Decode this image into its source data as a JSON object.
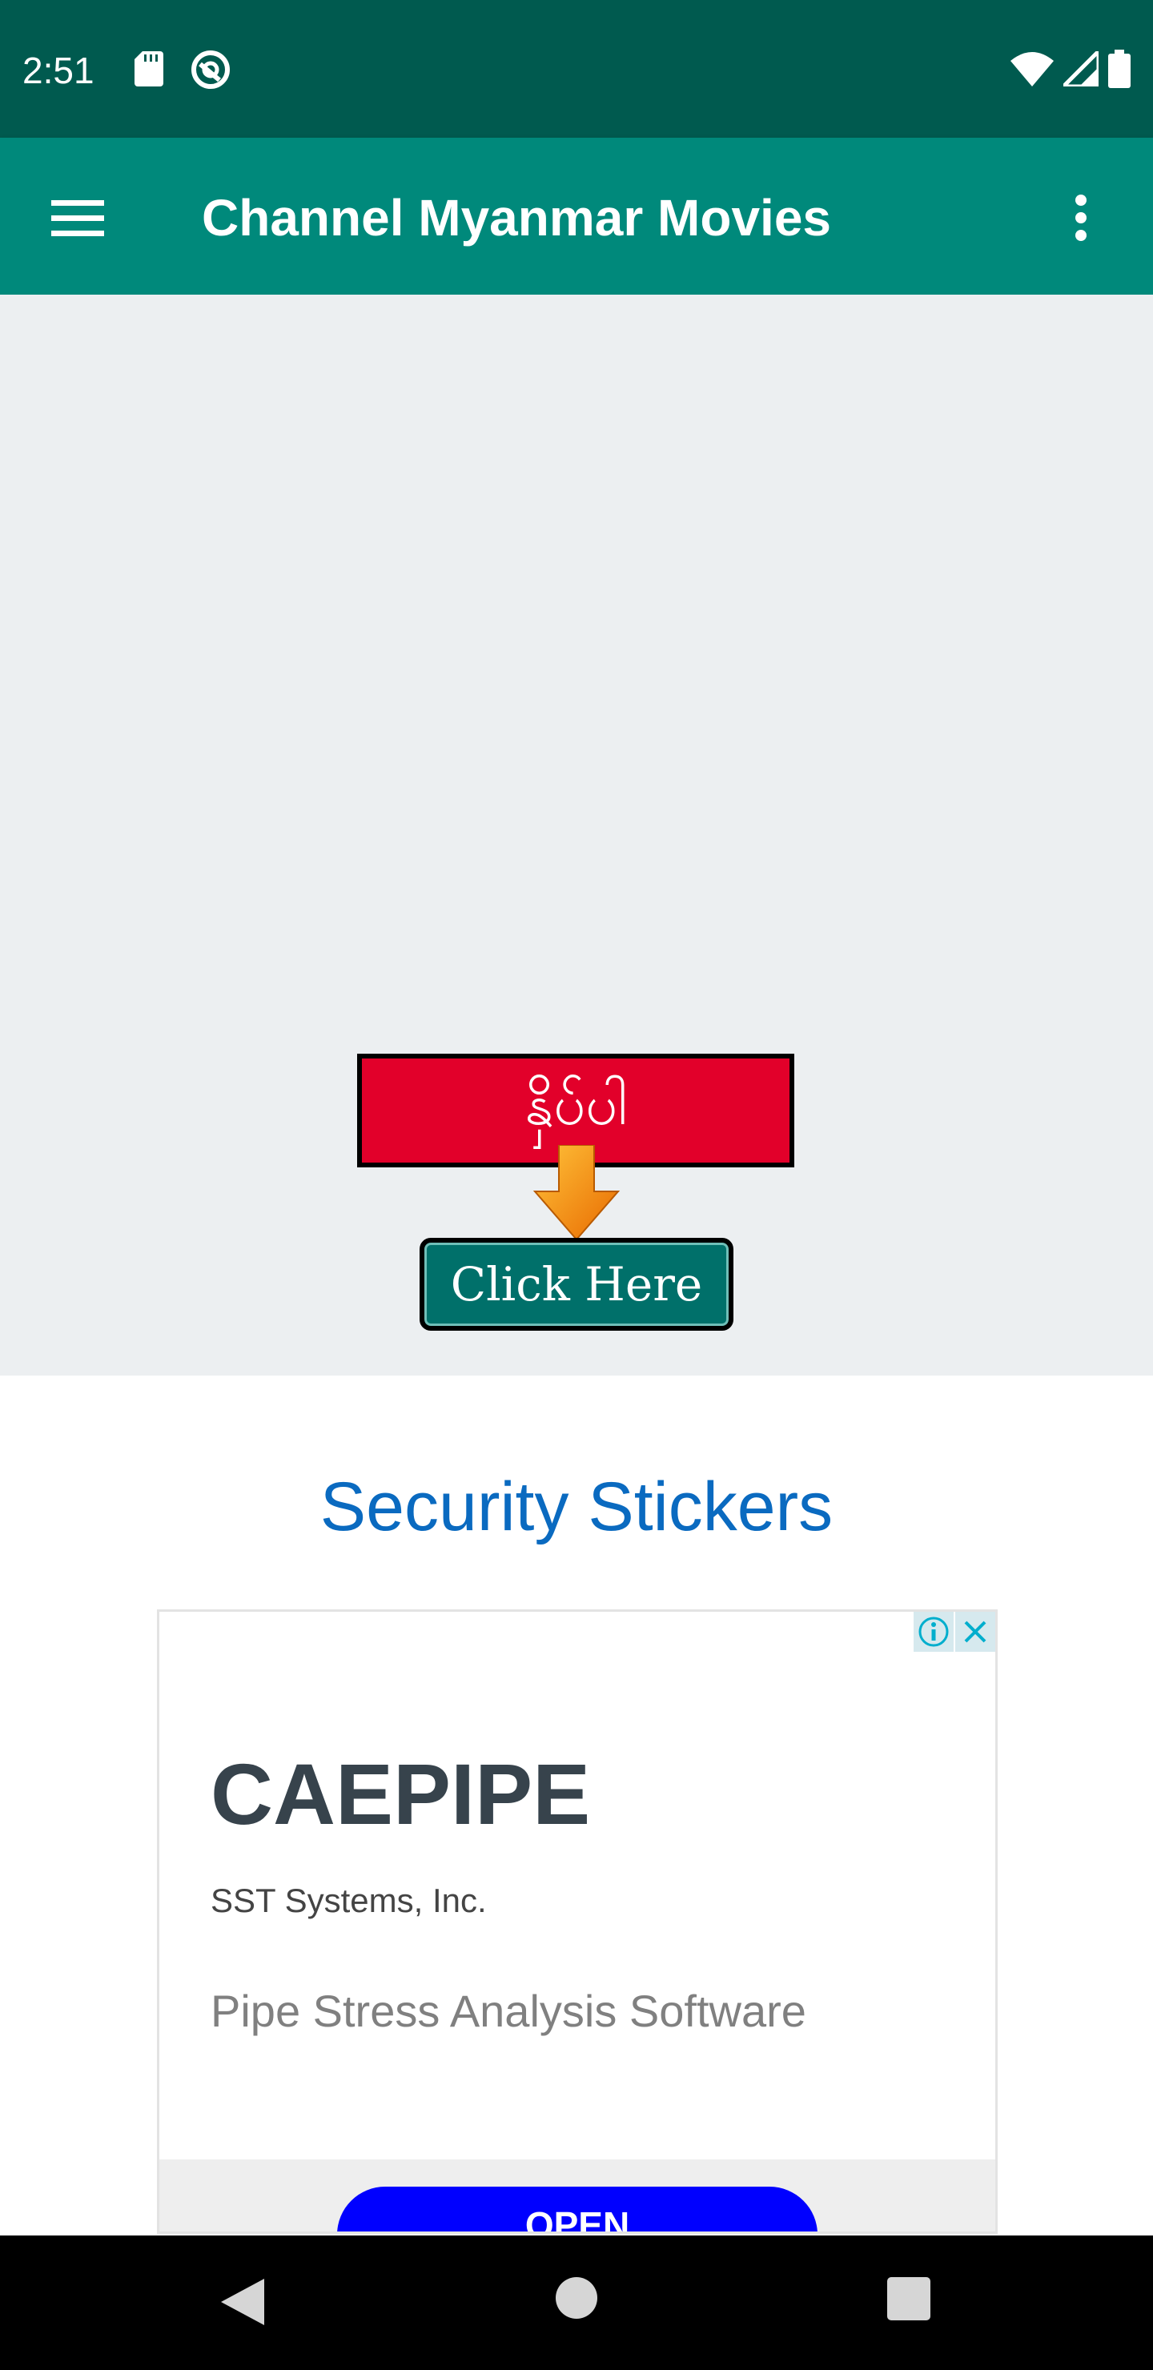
{
  "status_bar": {
    "time": "2:51",
    "icons": [
      "sd-card-icon",
      "sync-icon",
      "wifi-icon",
      "signal-icon",
      "battery-icon"
    ]
  },
  "app_bar": {
    "title": "Channel Myanmar Movies",
    "menu_icon": "hamburger-menu-icon",
    "overflow_icon": "more-vert-icon",
    "color": "#00897B"
  },
  "banner": {
    "burmese_text": "နှိပ်ပါ",
    "button_label": "Click Here"
  },
  "sticker_section": {
    "heading": "Security Stickers",
    "color": "#0A6AC0"
  },
  "ad": {
    "product": "CAEPIPE",
    "company": "SST Systems, Inc.",
    "description": "Pipe Stress Analysis Software",
    "cta": "OPEN"
  },
  "nav_bar": {
    "back_icon": "back-icon",
    "home_icon": "home-icon",
    "recents_icon": "recents-icon"
  }
}
